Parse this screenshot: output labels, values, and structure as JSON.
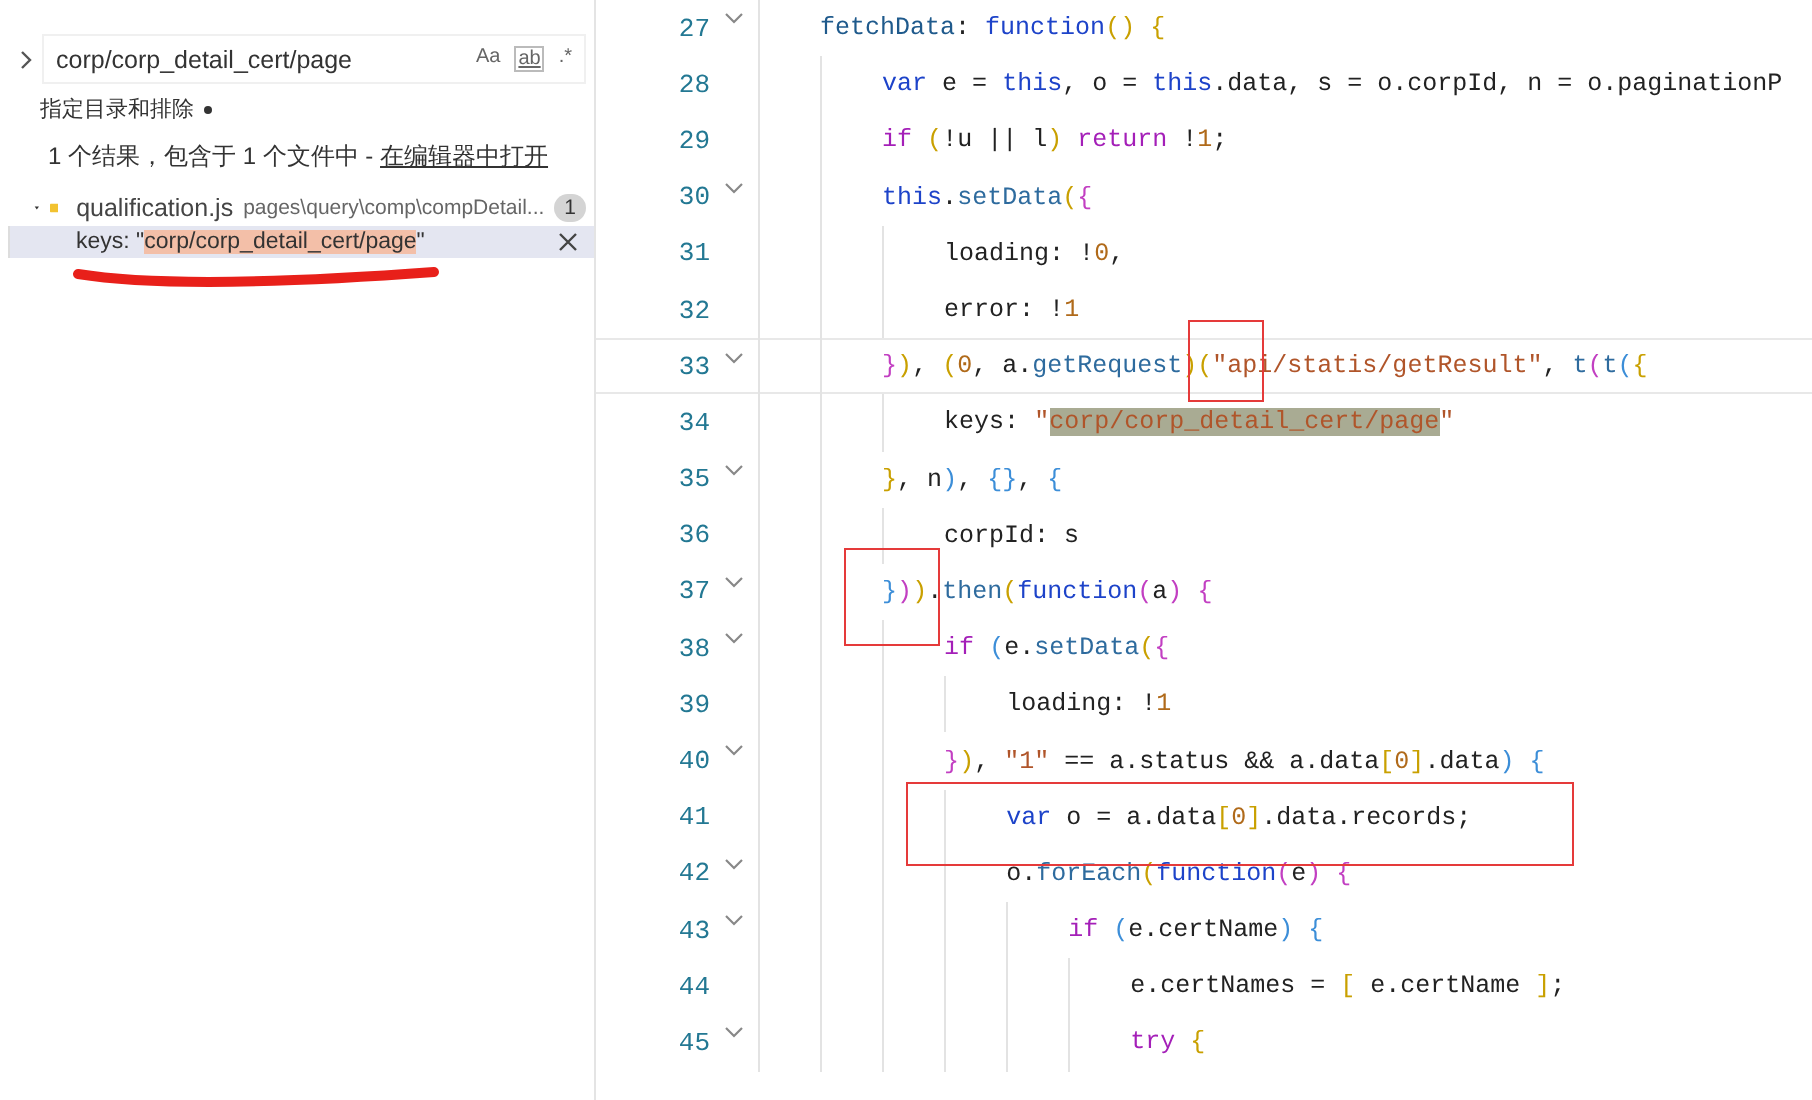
{
  "search": {
    "replace_expanded": false,
    "query": "corp/corp_detail_cert/page",
    "options": [
      "Aa",
      "ab",
      ".*"
    ]
  },
  "include_exclude": {
    "label": "指定目录和排除",
    "expanded": false
  },
  "summary": {
    "text": "1 个结果，包含于 1 个文件中 - ",
    "link": "在编辑器中打开"
  },
  "results": [
    {
      "file": "qualification.js",
      "path": "pages\\query\\comp\\compDetail...",
      "count": "1",
      "expanded": true,
      "matches": [
        {
          "prefix": "keys: \"",
          "match": "corp/corp_detail_cert/page",
          "suffix": "\"",
          "selected": true
        }
      ]
    }
  ],
  "editor": {
    "lines": [
      {
        "number": "27",
        "foldable": true,
        "current": false,
        "tokens": [
          {
            "kind": "prop",
            "text": "    fetchData"
          },
          {
            "kind": "plain",
            "text": ": "
          },
          {
            "kind": "keyword",
            "text": "function"
          },
          {
            "kind": "b1",
            "text": "() "
          },
          {
            "kind": "b1",
            "text": "{"
          }
        ]
      },
      {
        "number": "28",
        "foldable": false,
        "current": false,
        "tokens": [
          {
            "kind": "keyword",
            "text": "        var"
          },
          {
            "kind": "plain",
            "text": " e = "
          },
          {
            "kind": "keyword",
            "text": "this"
          },
          {
            "kind": "plain",
            "text": ", o = "
          },
          {
            "kind": "keyword",
            "text": "this"
          },
          {
            "kind": "plain",
            "text": ".data, s = o.corpId, n = o.paginationP"
          }
        ]
      },
      {
        "number": "29",
        "foldable": false,
        "current": false,
        "tokens": [
          {
            "kind": "control",
            "text": "        if "
          },
          {
            "kind": "b1",
            "text": "("
          },
          {
            "kind": "plain",
            "text": "!u || l"
          },
          {
            "kind": "b1",
            "text": ") "
          },
          {
            "kind": "control",
            "text": "return"
          },
          {
            "kind": "plain",
            "text": " !"
          },
          {
            "kind": "number",
            "text": "1"
          },
          {
            "kind": "plain",
            "text": ";"
          }
        ]
      },
      {
        "number": "30",
        "foldable": true,
        "current": false,
        "tokens": [
          {
            "kind": "keyword",
            "text": "        this"
          },
          {
            "kind": "plain",
            "text": "."
          },
          {
            "kind": "func",
            "text": "setData"
          },
          {
            "kind": "b1",
            "text": "("
          },
          {
            "kind": "b2",
            "text": "{"
          }
        ]
      },
      {
        "number": "31",
        "foldable": false,
        "current": false,
        "tokens": [
          {
            "kind": "plain",
            "text": "            loading: !"
          },
          {
            "kind": "number",
            "text": "0"
          },
          {
            "kind": "plain",
            "text": ","
          }
        ]
      },
      {
        "number": "32",
        "foldable": false,
        "current": false,
        "tokens": [
          {
            "kind": "plain",
            "text": "            error: !"
          },
          {
            "kind": "number",
            "text": "1"
          }
        ]
      },
      {
        "number": "33",
        "foldable": true,
        "current": true,
        "tokens": [
          {
            "kind": "b2",
            "text": "        }"
          },
          {
            "kind": "b1",
            "text": ")"
          },
          {
            "kind": "plain",
            "text": ", "
          },
          {
            "kind": "b1",
            "text": "("
          },
          {
            "kind": "number",
            "text": "0"
          },
          {
            "kind": "plain",
            "text": ", a."
          },
          {
            "kind": "func",
            "text": "getRequest"
          },
          {
            "kind": "b1",
            "text": ")"
          },
          {
            "kind": "b1",
            "text": "("
          },
          {
            "kind": "string",
            "text": "\"api/statis/getResult\""
          },
          {
            "kind": "plain",
            "text": ", "
          },
          {
            "kind": "func",
            "text": "t"
          },
          {
            "kind": "b2",
            "text": "("
          },
          {
            "kind": "func",
            "text": "t"
          },
          {
            "kind": "b3",
            "text": "("
          },
          {
            "kind": "b1",
            "text": "{"
          }
        ]
      },
      {
        "number": "34",
        "foldable": false,
        "current": false,
        "tokens": [
          {
            "kind": "plain",
            "text": "            keys: "
          },
          {
            "kind": "string",
            "text": "\""
          },
          {
            "kind": "match",
            "text": "corp/corp_detail_cert/page"
          },
          {
            "kind": "string",
            "text": "\""
          }
        ]
      },
      {
        "number": "35",
        "foldable": true,
        "current": false,
        "tokens": [
          {
            "kind": "b1",
            "text": "        }"
          },
          {
            "kind": "plain",
            "text": ", n"
          },
          {
            "kind": "b3",
            "text": ")"
          },
          {
            "kind": "plain",
            "text": ", "
          },
          {
            "kind": "b3",
            "text": "{}"
          },
          {
            "kind": "plain",
            "text": ", "
          },
          {
            "kind": "b3",
            "text": "{"
          }
        ]
      },
      {
        "number": "36",
        "foldable": false,
        "current": false,
        "tokens": [
          {
            "kind": "plain",
            "text": "            corpId: s"
          }
        ]
      },
      {
        "number": "37",
        "foldable": true,
        "current": false,
        "tokens": [
          {
            "kind": "b3",
            "text": "        }"
          },
          {
            "kind": "b2",
            "text": ")"
          },
          {
            "kind": "b1",
            "text": ")"
          },
          {
            "kind": "plain",
            "text": "."
          },
          {
            "kind": "func",
            "text": "then"
          },
          {
            "kind": "b1",
            "text": "("
          },
          {
            "kind": "keyword",
            "text": "function"
          },
          {
            "kind": "b2",
            "text": "("
          },
          {
            "kind": "plain",
            "text": "a"
          },
          {
            "kind": "b2",
            "text": ") "
          },
          {
            "kind": "b2",
            "text": "{"
          }
        ]
      },
      {
        "number": "38",
        "foldable": true,
        "current": false,
        "tokens": [
          {
            "kind": "control",
            "text": "            if "
          },
          {
            "kind": "b3",
            "text": "("
          },
          {
            "kind": "plain",
            "text": "e."
          },
          {
            "kind": "func",
            "text": "setData"
          },
          {
            "kind": "b1",
            "text": "("
          },
          {
            "kind": "b2",
            "text": "{"
          }
        ]
      },
      {
        "number": "39",
        "foldable": false,
        "current": false,
        "tokens": [
          {
            "kind": "plain",
            "text": "                loading: !"
          },
          {
            "kind": "number",
            "text": "1"
          }
        ]
      },
      {
        "number": "40",
        "foldable": true,
        "current": false,
        "tokens": [
          {
            "kind": "b2",
            "text": "            }"
          },
          {
            "kind": "b1",
            "text": ")"
          },
          {
            "kind": "plain",
            "text": ", "
          },
          {
            "kind": "string",
            "text": "\"1\""
          },
          {
            "kind": "plain",
            "text": " == a.status && a.data"
          },
          {
            "kind": "b1",
            "text": "["
          },
          {
            "kind": "number",
            "text": "0"
          },
          {
            "kind": "b1",
            "text": "]"
          },
          {
            "kind": "plain",
            "text": ".data"
          },
          {
            "kind": "b3",
            "text": ") "
          },
          {
            "kind": "b3",
            "text": "{"
          }
        ]
      },
      {
        "number": "41",
        "foldable": false,
        "current": false,
        "tokens": [
          {
            "kind": "keyword",
            "text": "                var"
          },
          {
            "kind": "plain",
            "text": " o = a.data"
          },
          {
            "kind": "b1",
            "text": "["
          },
          {
            "kind": "number",
            "text": "0"
          },
          {
            "kind": "b1",
            "text": "]"
          },
          {
            "kind": "plain",
            "text": ".data.records;"
          }
        ]
      },
      {
        "number": "42",
        "foldable": true,
        "current": false,
        "tokens": [
          {
            "kind": "plain",
            "text": "                o."
          },
          {
            "kind": "func",
            "text": "forEach"
          },
          {
            "kind": "b1",
            "text": "("
          },
          {
            "kind": "keyword",
            "text": "function"
          },
          {
            "kind": "b2",
            "text": "("
          },
          {
            "kind": "plain",
            "text": "e"
          },
          {
            "kind": "b2",
            "text": ") "
          },
          {
            "kind": "b2",
            "text": "{"
          }
        ]
      },
      {
        "number": "43",
        "foldable": true,
        "current": false,
        "tokens": [
          {
            "kind": "control",
            "text": "                    if "
          },
          {
            "kind": "b3",
            "text": "("
          },
          {
            "kind": "plain",
            "text": "e.certName"
          },
          {
            "kind": "b3",
            "text": ") "
          },
          {
            "kind": "b3",
            "text": "{"
          }
        ]
      },
      {
        "number": "44",
        "foldable": false,
        "current": false,
        "tokens": [
          {
            "kind": "plain",
            "text": "                        e.certNames = "
          },
          {
            "kind": "b1",
            "text": "["
          },
          {
            "kind": "plain",
            "text": " e.certName "
          },
          {
            "kind": "b1",
            "text": "]"
          },
          {
            "kind": "plain",
            "text": ";"
          }
        ]
      },
      {
        "number": "45",
        "foldable": true,
        "current": false,
        "tokens": [
          {
            "kind": "control",
            "text": "                        try "
          },
          {
            "kind": "b1",
            "text": "{"
          }
        ]
      }
    ]
  }
}
